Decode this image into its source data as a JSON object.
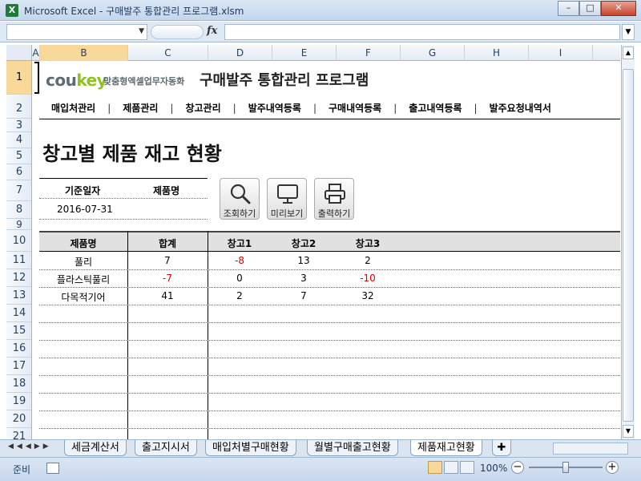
{
  "window": {
    "title": "Microsoft Excel - 구매발주 통합관리 프로그램.xlsm",
    "app_icon": "X"
  },
  "formula_bar": {
    "fx_label": "fx",
    "name_box_value": "",
    "formula_value": ""
  },
  "columns": [
    "A",
    "B",
    "C",
    "D",
    "E",
    "F",
    "G",
    "H",
    "I"
  ],
  "rows": [
    "1",
    "2",
    "3",
    "4",
    "5",
    "6",
    "7",
    "8",
    "9",
    "10",
    "11",
    "12",
    "13",
    "14",
    "15",
    "16",
    "17",
    "18",
    "19",
    "20",
    "21"
  ],
  "header": {
    "logo_part1": "cou",
    "logo_part2": "key",
    "logo_tagline": "맞춤형엑셀업무자동화",
    "program_title": "구매발주 통합관리 프로그램"
  },
  "nav": {
    "items": [
      "매입처관리",
      "제품관리",
      "창고관리",
      "발주내역등록",
      "구매내역등록",
      "출고내역등록",
      "발주요청내역서"
    ],
    "separator": "|"
  },
  "page_heading": "창고별 제품 재고 현황",
  "filter": {
    "date_label": "기준일자",
    "product_label": "제품명",
    "date_value": "2016-07-31",
    "product_value": ""
  },
  "actions": {
    "search": "조회하기",
    "preview": "미리보기",
    "print": "출력하기"
  },
  "table": {
    "headers": [
      "제품명",
      "합계",
      "창고1",
      "창고2",
      "창고3"
    ],
    "rows": [
      {
        "name": "풀리",
        "total": "7",
        "w1": "-8",
        "w2": "13",
        "w3": "2"
      },
      {
        "name": "플라스틱풀리",
        "total": "-7",
        "w1": "0",
        "w2": "3",
        "w3": "-10"
      },
      {
        "name": "다목적기어",
        "total": "41",
        "w1": "2",
        "w2": "7",
        "w3": "32"
      }
    ],
    "negative_color": "#e00000"
  },
  "sheet_tabs": [
    "세금계산서",
    "출고지시서",
    "매입처별구매현황",
    "월별구매출고현황",
    "제품재고현황"
  ],
  "status": {
    "ready": "준비",
    "zoom": "100%"
  }
}
